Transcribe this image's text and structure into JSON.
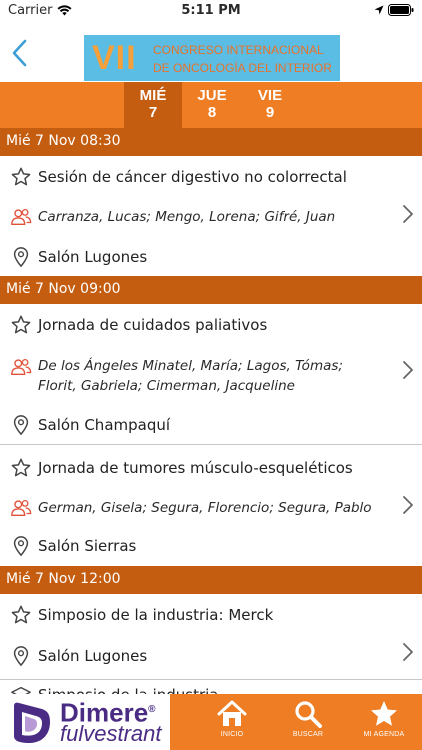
{
  "status_bar": {
    "carrier": "Carrier",
    "time": "5:11 PM"
  },
  "banner": {
    "roman": "VII",
    "line1": "CONGRESO INTERNACIONAL",
    "line2": "DE  ONCOLOGÍA DEL INTERIOR"
  },
  "day_tabs": [
    {
      "weekday": "MIÉ",
      "day": "7",
      "active": true
    },
    {
      "weekday": "JUE",
      "day": "8",
      "active": false
    },
    {
      "weekday": "VIE",
      "day": "9",
      "active": false
    }
  ],
  "agenda": {
    "headers": [
      "Mié 7 Nov 08:30",
      "Mié 7 Nov 09:00",
      "Mié 7 Nov 12:00"
    ],
    "sessions": [
      {
        "title": "Sesión de cáncer digestivo no colorrectal",
        "speakers": "Carranza, Lucas; Mengo, Lorena; Gifré, Juan",
        "room": "Salón Lugones"
      },
      {
        "title": "Jornada de cuidados paliativos",
        "speakers": "De los Ángeles Minatel, María; Lagos, Tómas; Florit, Gabriela; Cimerman, Jacqueline",
        "room": "Salón Champaquí"
      },
      {
        "title": "Jornada de tumores músculo-esqueléticos",
        "speakers": "German, Gisela; Segura, Florencio; Segura, Pablo",
        "room": "Salón Sierras"
      },
      {
        "title": "Simposio de la industria: Merck",
        "room": "Salón Lugones"
      },
      {
        "title": "Simposio de la industria"
      }
    ]
  },
  "ad": {
    "brand": "Dimere",
    "reg": "®",
    "drug": "fulvestrant"
  },
  "tabbar": [
    {
      "label": "INICIO",
      "icon": "home-icon"
    },
    {
      "label": "BUSCAR",
      "icon": "search-icon"
    },
    {
      "label": "MI AGENDA",
      "icon": "star-icon"
    }
  ],
  "colors": {
    "orange": "#ee7d24",
    "dark_orange": "#c45d10",
    "banner_blue": "#5bbde3",
    "back_arrow": "#3d9fd6",
    "speaker_icon": "#e0523a",
    "brand_purple": "#4a2c84"
  }
}
